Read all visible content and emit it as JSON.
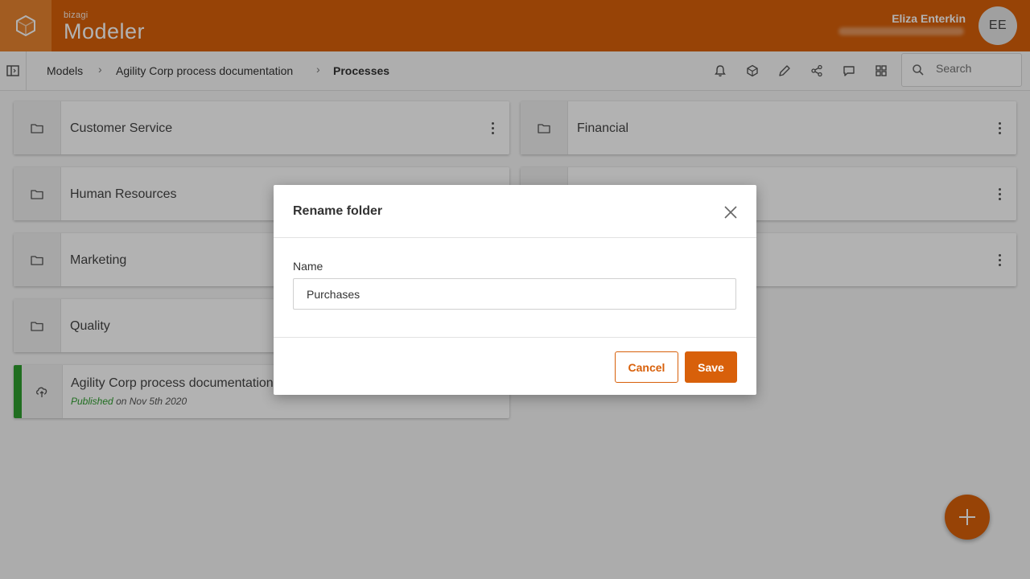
{
  "header": {
    "brand_small": "bizagi",
    "brand_name": "Modeler",
    "user_name": "Eliza Enterkin",
    "avatar_initials": "EE",
    "accent_color": "#d8600a"
  },
  "toolbar": {
    "breadcrumbs": [
      "Models",
      "Agility Corp process documentation",
      "Processes"
    ],
    "icons": [
      "bell-icon",
      "hexagon-icon",
      "pencil-icon",
      "share-icon",
      "comment-icon",
      "grid-icon"
    ],
    "search_placeholder": "Search"
  },
  "folders": [
    {
      "name": "Customer Service"
    },
    {
      "name": "Financial"
    },
    {
      "name": "Human Resources"
    },
    {
      "name": ""
    },
    {
      "name": "Marketing"
    },
    {
      "name": ""
    },
    {
      "name": "Quality"
    }
  ],
  "model_card": {
    "title": "Agility Corp process documentation",
    "status": "Published",
    "date_text": "on Nov 5th 2020"
  },
  "dialog": {
    "title": "Rename folder",
    "field_label": "Name",
    "field_value": "Purchases",
    "cancel_label": "Cancel",
    "save_label": "Save"
  }
}
